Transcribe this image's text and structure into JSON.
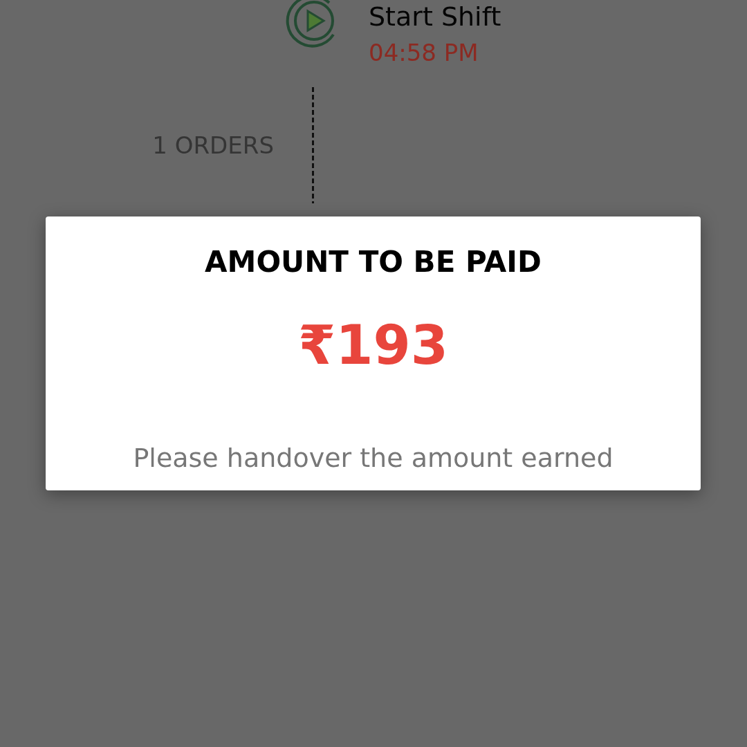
{
  "timeline": {
    "start": {
      "label": "Start Shift",
      "time": "04:58 PM"
    },
    "orders": "1 ORDERS"
  },
  "dialog": {
    "title": "AMOUNT TO BE PAID",
    "amount": "₹193",
    "message": "Please handover the amount earned"
  }
}
